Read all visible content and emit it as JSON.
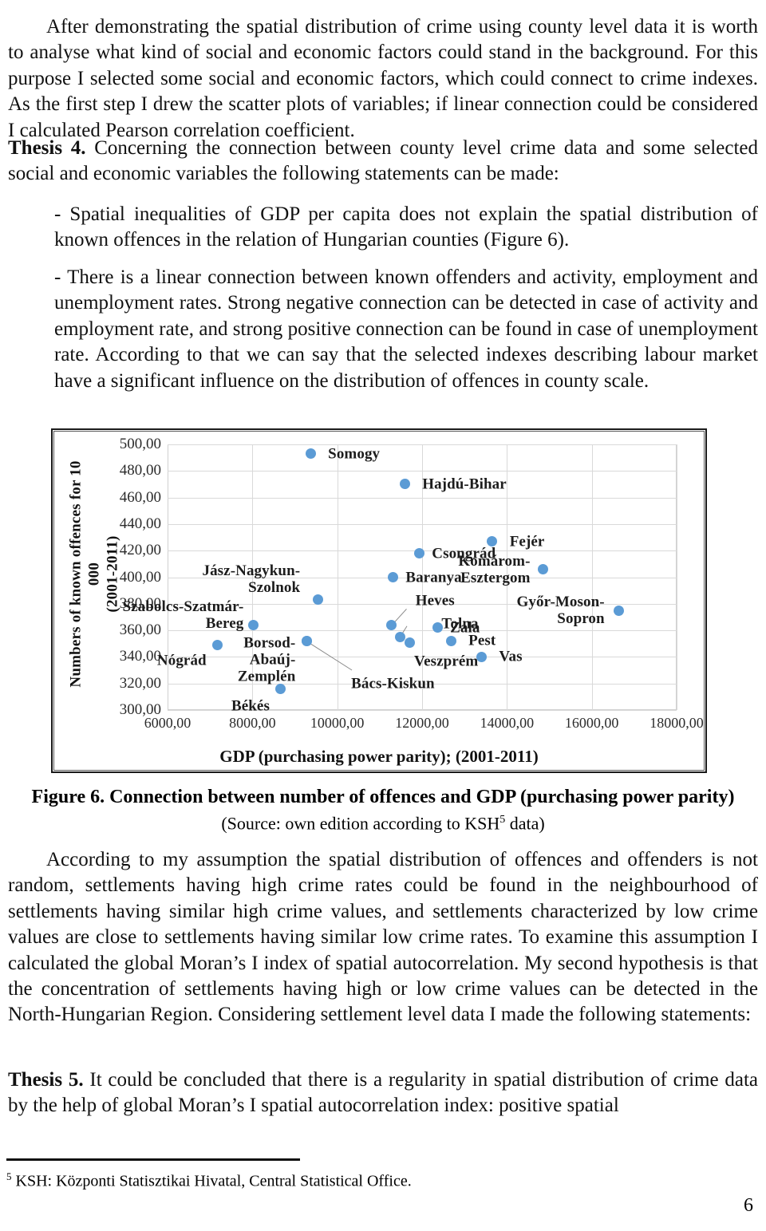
{
  "document": {
    "paragraphs": {
      "intro": "After demonstrating the spatial distribution of crime using county level data it is worth to analyse what kind of social and economic factors could stand in the background. For this purpose I selected some social and economic factors, which could connect to crime indexes. As the first step I drew the scatter plots of variables; if linear connection could be considered I calculated Pearson correlation coefficient.",
      "thesis4_label": "Thesis 4.",
      "thesis4_body": " Concerning the connection between county level crime data and some selected social and economic variables the following statements can be made:",
      "bullet1": "- Spatial inequalities of GDP per capita does not explain the spatial distribution of known offences in the relation of Hungarian counties (Figure 6).",
      "bullet2": "- There is a linear connection between known offenders and activity, employment and unemployment rates. Strong negative connection can be detected in case of activity and employment rate, and strong positive connection can be found in case of unemployment rate. According to that we can say that the selected indexes describing labour market have a significant influence on the distribution of offences in county scale.",
      "after_figure": "According to my assumption the spatial distribution of offences and offenders is not random, settlements having high crime rates could be found in the neighbourhood of settlements having similar high crime values, and settlements characterized by low crime values are close to settlements having similar low crime rates. To examine this assumption I calculated the global Moran’s I index of spatial autocorrelation. My second hypothesis is that the concentration of settlements having high or low crime values can be detected in the North-Hungarian Region. Considering settlement level data I made the following statements:",
      "thesis5_label": "Thesis 5.",
      "thesis5_body": " It could be concluded that there is a regularity in spatial distribution of crime data by the help of global Moran’s I spatial autocorrelation index: positive spatial"
    },
    "caption": {
      "main": "Figure 6. Connection between number of offences and GDP (purchasing power parity)",
      "source_before": "(Source: own edition according to KSH",
      "source_sup": "5",
      "source_after": " data)"
    },
    "footnote": {
      "marker": "5",
      "text": " KSH: Központi Statisztikai Hivatal, Central Statistical Office."
    },
    "page_number": "6"
  },
  "chart_data": {
    "type": "scatter",
    "title": "",
    "xlabel": "GDP (purchasing power parity); (2001-2011)",
    "ylabel": "Numbers of known offences for 10 000 (2001-2011)",
    "ylabel_line1": "Numbers of known offences for 10 000",
    "ylabel_line2": "(2001-2011)",
    "xlim": [
      6000,
      18000
    ],
    "ylim": [
      300,
      500
    ],
    "xticks": [
      6000,
      8000,
      10000,
      12000,
      14000,
      16000,
      18000
    ],
    "xtick_labels": [
      "6000,00",
      "8000,00",
      "10000,00",
      "12000,00",
      "14000,00",
      "16000,00",
      "18000,00"
    ],
    "yticks": [
      300,
      320,
      340,
      360,
      380,
      400,
      420,
      440,
      460,
      480,
      500
    ],
    "ytick_labels": [
      "300,00",
      "320,00",
      "340,00",
      "360,00",
      "380,00",
      "400,00",
      "420,00",
      "440,00",
      "460,00",
      "480,00",
      "500,00"
    ],
    "grid": true,
    "legend": false,
    "marker_color": "#5b9bd5",
    "points": [
      {
        "label": "Somogy",
        "x": 9370,
        "y": 493,
        "label_pos": "right",
        "label_dx": 22,
        "label_dy": 0
      },
      {
        "label": "Hajdú-Bihar",
        "x": 11590,
        "y": 470,
        "label_pos": "right",
        "label_dx": 22,
        "label_dy": 0
      },
      {
        "label": "Fejér",
        "x": 13650,
        "y": 427,
        "label_pos": "right",
        "label_dx": 22,
        "label_dy": 0
      },
      {
        "label": "Csongrád",
        "x": 11930,
        "y": 418,
        "label_pos": "right",
        "label_dx": 16,
        "label_dy": 0
      },
      {
        "label": "Baranya",
        "x": 11310,
        "y": 400,
        "label_pos": "right",
        "label_dx": 16,
        "label_dy": 0
      },
      {
        "label": "Komárom-\nEsztergom",
        "x": 14850,
        "y": 406,
        "label_pos": "left",
        "label_dx": -16,
        "label_dy": 0
      },
      {
        "label": "Győr-Moson-\nSopron",
        "x": 16640,
        "y": 375,
        "label_pos": "left",
        "label_dx": -18,
        "label_dy": 0
      },
      {
        "label": "Jász-Nagykun-\nSzolnok",
        "x": 9540,
        "y": 383,
        "label_pos": "left",
        "label_dx": -22,
        "label_dy": -26
      },
      {
        "label": "Szabolcs-Szatmár-\nBereg",
        "x": 8020,
        "y": 364,
        "label_pos": "left",
        "label_dx": -12,
        "label_dy": -12
      },
      {
        "label": "Heves",
        "x": 11280,
        "y": 364,
        "label_pos": "right",
        "label_dx": 30,
        "label_dy": -30
      },
      {
        "label": "Tolna",
        "x": 11480,
        "y": 355,
        "label_pos": "right",
        "label_dx": 52,
        "label_dy": -16
      },
      {
        "label": "Veszprém",
        "x": 11700,
        "y": 351,
        "label_pos": "right",
        "label_dx": 6,
        "label_dy": 24
      },
      {
        "label": "Borsod-\nAbaúj-\nZemplén",
        "x": 9280,
        "y": 352,
        "label_pos": "left",
        "label_dx": -14,
        "label_dy": 24
      },
      {
        "label": "Bács-Kiskun",
        "x": 9280,
        "y": 352,
        "label_pos": "center",
        "label_dx": 108,
        "label_dy": 54
      },
      {
        "label": "Zala",
        "x": 12360,
        "y": 362,
        "label_pos": "right",
        "label_dx": 16,
        "label_dy": 0
      },
      {
        "label": "Pest",
        "x": 12680,
        "y": 352,
        "label_pos": "right",
        "label_dx": 22,
        "label_dy": 0
      },
      {
        "label": "Vas",
        "x": 13400,
        "y": 340,
        "label_pos": "right",
        "label_dx": 22,
        "label_dy": 0
      },
      {
        "label": "Nógrád",
        "x": 7180,
        "y": 349,
        "label_pos": "left",
        "label_dx": -14,
        "label_dy": 20
      },
      {
        "label": "Békés",
        "x": 8670,
        "y": 316,
        "label_pos": "left",
        "label_dx": -14,
        "label_dy": 22
      }
    ],
    "leaders": [
      {
        "from_x": 11280,
        "from_y": 364,
        "to_x": 11620,
        "to_y": 376
      },
      {
        "from_x": 11480,
        "from_y": 355,
        "to_x": 11640,
        "to_y": 363
      },
      {
        "from_x": 9280,
        "from_y": 352,
        "to_x": 10360,
        "to_y": 330
      }
    ]
  }
}
